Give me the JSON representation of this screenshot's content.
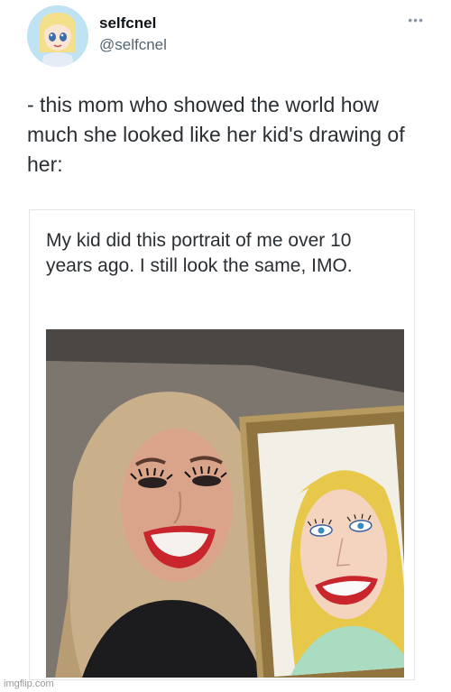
{
  "tweet": {
    "display_name": "selfcnel",
    "handle": "@selfcnel",
    "more_icon": "more-icon",
    "text": "- this mom who showed the world how much she looked like her kid's drawing of her:"
  },
  "card": {
    "caption": "My kid did this portrait of me over 10 years ago. I still look the same, IMO."
  },
  "watermark": "imgflip.com"
}
